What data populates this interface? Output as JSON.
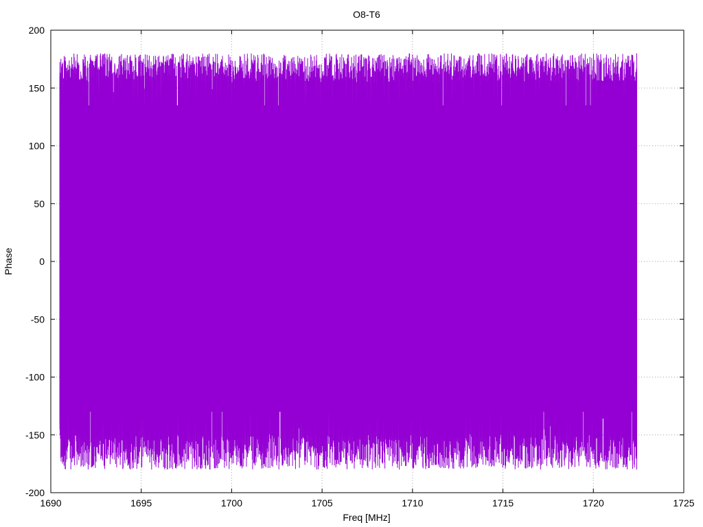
{
  "chart_data": {
    "type": "line",
    "title": "O8-T6",
    "xlabel": "Freq [MHz]",
    "ylabel": "Phase",
    "xlim": [
      1690,
      1725
    ],
    "ylim": [
      -200,
      200
    ],
    "x_ticks": [
      1690,
      1695,
      1700,
      1705,
      1710,
      1715,
      1720,
      1725
    ],
    "y_ticks": [
      -200,
      -150,
      -100,
      -50,
      0,
      50,
      100,
      150,
      200
    ],
    "grid": true,
    "legend": "none",
    "series": [
      {
        "color": "#9400d3",
        "x_range": [
          1690.5,
          1722.4
        ],
        "y_envelope": [
          -180,
          180
        ],
        "description_points": [
          {
            "x": 1690.5,
            "y": 160
          },
          {
            "x": 1690.5,
            "y": -145
          },
          {
            "x": 1694.0,
            "y": -55
          },
          {
            "x": 1695.0,
            "y": 55
          },
          {
            "x": 1697.6,
            "y": -57
          },
          {
            "x": 1703.4,
            "y": 30
          },
          {
            "x": 1710.3,
            "y": 65
          },
          {
            "x": 1722.4,
            "y": 180
          },
          {
            "x": 1722.4,
            "y": -180
          }
        ]
      }
    ]
  }
}
